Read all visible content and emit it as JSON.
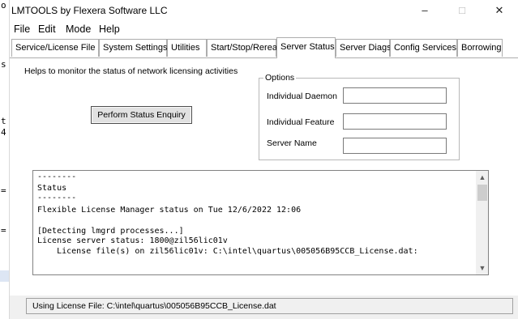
{
  "background_window": {
    "glyphs": [
      "o",
      "s",
      "t",
      "4",
      "=",
      "="
    ]
  },
  "window": {
    "title": "LMTOOLS by Flexera Software LLC",
    "controls": {
      "minimize": "–",
      "maximize": "□",
      "close": "✕"
    }
  },
  "menu": [
    "File",
    "Edit",
    "Mode",
    "Help"
  ],
  "tabs": [
    "Service/License File",
    "System Settings",
    "Utilities",
    "Start/Stop/Reread",
    "Server Status",
    "Server Diags",
    "Config Services",
    "Borrowing"
  ],
  "active_tab": "Server Status",
  "server_status": {
    "help_text": "Helps to monitor the status of network licensing activities",
    "enquiry_button": "Perform Status Enquiry",
    "options": {
      "legend": "Options",
      "individual_daemon_label": "Individual Daemon",
      "individual_daemon_value": "",
      "individual_feature_label": "Individual Feature",
      "individual_feature_value": "",
      "server_name_label": "Server Name",
      "server_name_value": ""
    },
    "output_lines": [
      "--------",
      "Status",
      "--------",
      "Flexible License Manager status on Tue 12/6/2022 12:06",
      "",
      "[Detecting lmgrd processes...]",
      "License server status: 1800@zil56lic01v",
      "    License file(s) on zil56lic01v: C:\\intel\\quartus\\005056B95CCB_License.dat:"
    ]
  },
  "statusbar": {
    "text": "Using License File:  C:\\intel\\quartus\\005056B95CCB_License.dat"
  }
}
